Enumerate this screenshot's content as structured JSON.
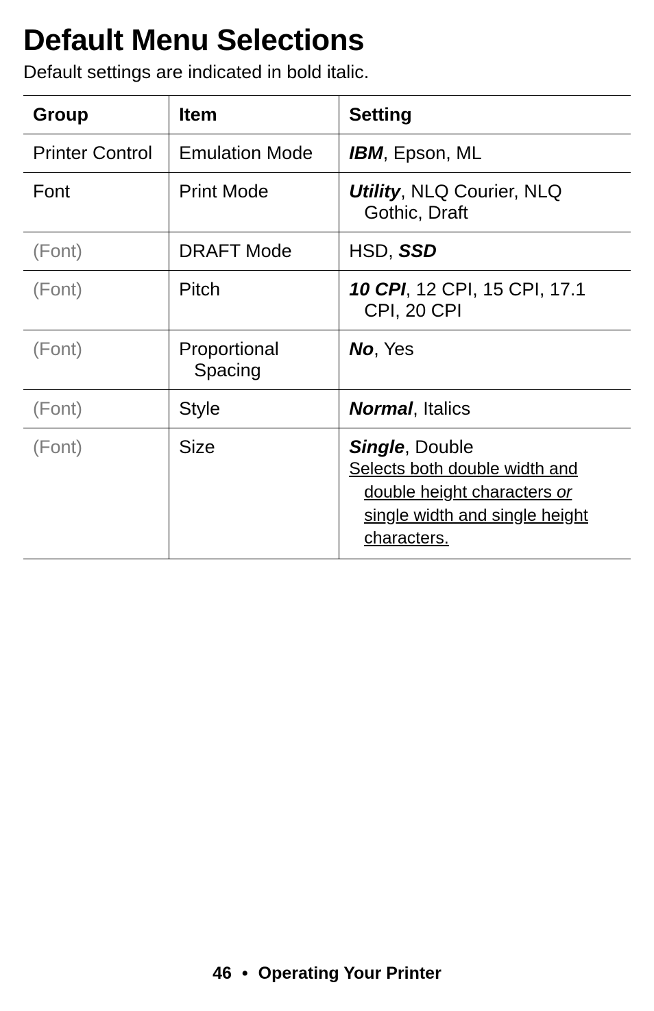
{
  "heading": "Default Menu Selections",
  "subtitle": "Default settings are indicated in bold italic.",
  "columns": {
    "group": "Group",
    "item": "Item",
    "setting": "Setting"
  },
  "rows": [
    {
      "group": "Printer Control",
      "groupMuted": false,
      "item": "Emulation Mode",
      "default": "IBM",
      "rest": ", Epson, ML",
      "line2": "",
      "note": ""
    },
    {
      "group": "Font",
      "groupMuted": false,
      "item": "Print Mode",
      "default": "Utility",
      "rest": ", NLQ Courier, NLQ",
      "line2": "Gothic, Draft",
      "note": ""
    },
    {
      "group": "(Font)",
      "groupMuted": true,
      "item": "DRAFT Mode",
      "prefix": "HSD, ",
      "default": "SSD",
      "rest": "",
      "line2": "",
      "note": ""
    },
    {
      "group": "(Font)",
      "groupMuted": true,
      "item": "Pitch",
      "default": "10 CPI",
      "rest": ", 12 CPI, 15 CPI, 17.1",
      "line2": "CPI, 20 CPI",
      "note": ""
    },
    {
      "group": "(Font)",
      "groupMuted": true,
      "item": "Proportional",
      "itemLine2": "Spacing",
      "default": "No",
      "rest": ", Yes",
      "line2": "",
      "note": ""
    },
    {
      "group": "(Font)",
      "groupMuted": true,
      "item": "Style",
      "default": "Normal",
      "rest": ", Italics",
      "line2": "",
      "note": ""
    },
    {
      "group": "(Font)",
      "groupMuted": true,
      "item": "Size",
      "default": "Single",
      "rest": ", Double",
      "line2": "",
      "note_l1": "Selects both double width and ",
      "note_l2": "double height characters ",
      "note_or": "or",
      "note_l3": " single width and single height ",
      "note_l4": "characters."
    }
  ],
  "footer": {
    "page": "46",
    "bullet": "•",
    "section": "Operating Your Printer"
  }
}
